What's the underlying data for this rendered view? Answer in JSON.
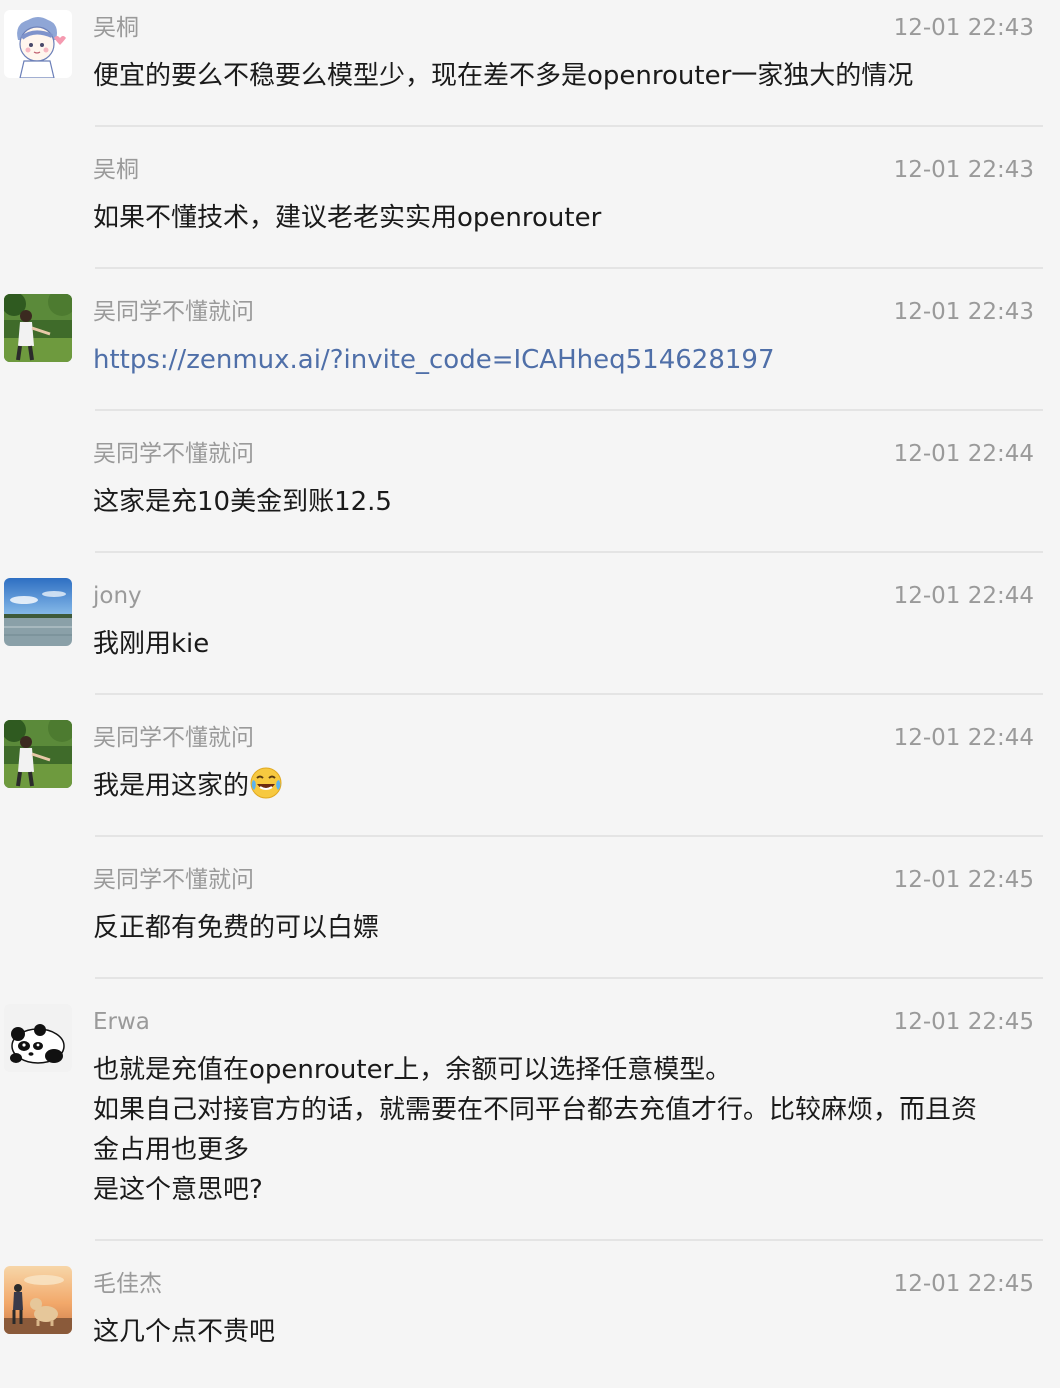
{
  "messages": [
    {
      "sender": "吴桐",
      "time": "12-01 22:43",
      "lines": [
        "便宜的要么不稳要么模型少，现在差不多是openrouter一家独大的情况"
      ],
      "avatar": "cartoon-boy-avatar"
    },
    {
      "sender": "吴桐",
      "time": "12-01 22:43",
      "lines": [
        "如果不懂技术，建议老老实实用openrouter"
      ]
    },
    {
      "sender": "吴同学不懂就问",
      "time": "12-01 22:43",
      "link": "https://zenmux.ai/?invite_code=ICAHheq514628197",
      "avatar": "man-in-field-avatar"
    },
    {
      "sender": "吴同学不懂就问",
      "time": "12-01 22:44",
      "lines": [
        "这家是充10美金到账12.5"
      ]
    },
    {
      "sender": "jony",
      "time": "12-01 22:44",
      "lines": [
        "我刚用kie"
      ],
      "avatar": "lake-landscape-avatar"
    },
    {
      "sender": "吴同学不懂就问",
      "time": "12-01 22:44",
      "text": "我是用这家的",
      "emoji": "tears-of-joy-emoji",
      "avatar": "man-in-field-avatar"
    },
    {
      "sender": "吴同学不懂就问",
      "time": "12-01 22:45",
      "lines": [
        "反正都有免费的可以白嫖"
      ]
    },
    {
      "sender": "Erwa",
      "time": "12-01 22:45",
      "lines": [
        "也就是充值在openrouter上，余额可以选择任意模型。",
        "如果自己对接官方的话，就需要在不同平台都去充值才行。比较麻烦，而且资",
        "金占用也更多",
        "是这个意思吧?"
      ],
      "avatar": "panda-avatar"
    },
    {
      "sender": "毛佳杰",
      "time": "12-01 22:45",
      "lines": [
        "这几个点不贵吧"
      ],
      "avatar": "boy-and-dog-sunset-avatar"
    }
  ],
  "colors": {
    "background": "#f5f5f5",
    "meta_text": "#9a9a9a",
    "message_text": "#1a1a1a",
    "link": "#4f6fa8",
    "divider": "#e4e4e4"
  }
}
